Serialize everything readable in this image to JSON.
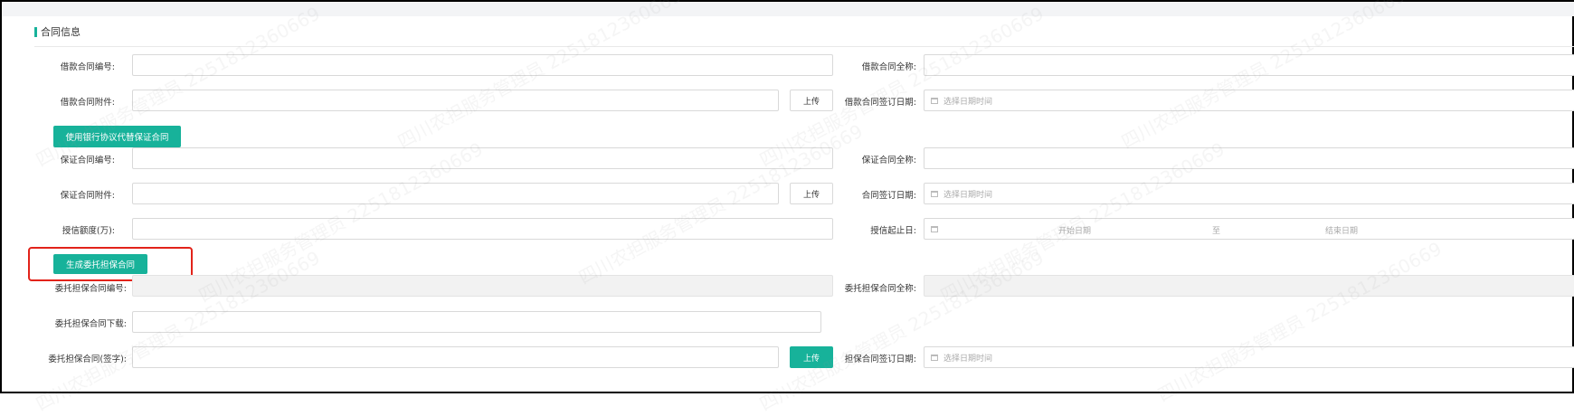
{
  "section": {
    "title": "合同信息"
  },
  "loan": {
    "contract_no_label": "借款合同编号:",
    "contract_name_label": "借款合同全称:",
    "attachment_label": "借款合同附件:",
    "upload_label": "上传",
    "sign_date_label": "借款合同签订日期:",
    "sign_date_placeholder": "选择日期时间"
  },
  "bank_button": "使用银行协议代替保证合同",
  "guarantee": {
    "contract_no_label": "保证合同编号:",
    "contract_name_label": "保证合同全称:",
    "attachment_label": "保证合同附件:",
    "upload_label": "上传",
    "sign_date_label": "合同签订日期:",
    "sign_date_placeholder": "选择日期时间",
    "credit_label": "授信额度(万):",
    "credit_range_label": "授信起止日:",
    "start_placeholder": "开始日期",
    "to_text": "至",
    "end_placeholder": "结束日期"
  },
  "generate_button": "生成委托担保合同",
  "entrust": {
    "contract_no_label": "委托担保合同编号:",
    "contract_name_label": "委托担保合同全称:",
    "download_label": "委托担保合同下载:",
    "signed_label": "委托担保合同(签字):",
    "upload_label": "上传",
    "sign_date_label": "担保合同签订日期:",
    "sign_date_placeholder": "选择日期时间"
  },
  "watermark_text": "四川农担服务管理员 2251812360669",
  "colors": {
    "accent": "#17b29a",
    "highlight": "#e2231a"
  }
}
